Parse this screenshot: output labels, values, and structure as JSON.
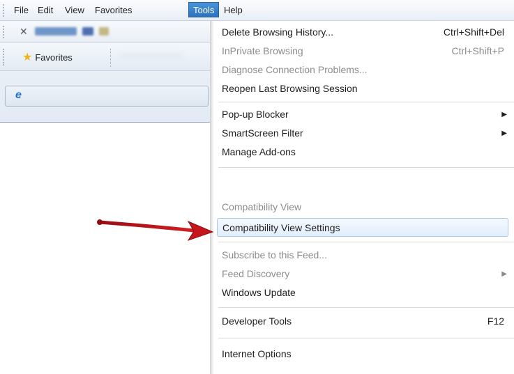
{
  "menubar": {
    "items": [
      "File",
      "Edit",
      "View",
      "Favorites",
      "Tools",
      "Help"
    ]
  },
  "favorites": {
    "label": "Favorites"
  },
  "tools_menu": {
    "items": [
      {
        "label": "Delete Browsing History...",
        "shortcut": "Ctrl+Shift+Del",
        "enabled": true
      },
      {
        "label": "InPrivate Browsing",
        "shortcut": "Ctrl+Shift+P",
        "enabled": false
      },
      {
        "label": "Diagnose Connection Problems...",
        "shortcut": "",
        "enabled": false
      },
      {
        "label": "Reopen Last Browsing Session",
        "shortcut": "",
        "enabled": true
      },
      {
        "label": "Pop-up Blocker",
        "shortcut": "",
        "enabled": true,
        "submenu": true
      },
      {
        "label": "SmartScreen Filter",
        "shortcut": "",
        "enabled": true,
        "submenu": true
      },
      {
        "label": "Manage Add-ons",
        "shortcut": "",
        "enabled": true
      },
      {
        "label": "Compatibility View",
        "shortcut": "",
        "enabled": false
      },
      {
        "label": "Compatibility View Settings",
        "shortcut": "",
        "enabled": true,
        "highlighted": true
      },
      {
        "label": "Subscribe to this Feed...",
        "shortcut": "",
        "enabled": false
      },
      {
        "label": "Feed Discovery",
        "shortcut": "",
        "enabled": false,
        "submenu": true
      },
      {
        "label": "Windows Update",
        "shortcut": "",
        "enabled": true
      },
      {
        "label": "Developer Tools",
        "shortcut": "F12",
        "enabled": true
      },
      {
        "label": "Internet Options",
        "shortcut": "",
        "enabled": true
      }
    ]
  },
  "icons": {
    "close": "close-icon",
    "star": "favorites-star-icon",
    "ie": "internet-explorer-icon",
    "submenu_arrow": "chevron-right-icon",
    "annotation": "red-arrow-annotation"
  },
  "colors": {
    "active_menu": "#2c72c0",
    "highlight_border": "#a6c8ee",
    "annotation_arrow": "#c0141a"
  }
}
